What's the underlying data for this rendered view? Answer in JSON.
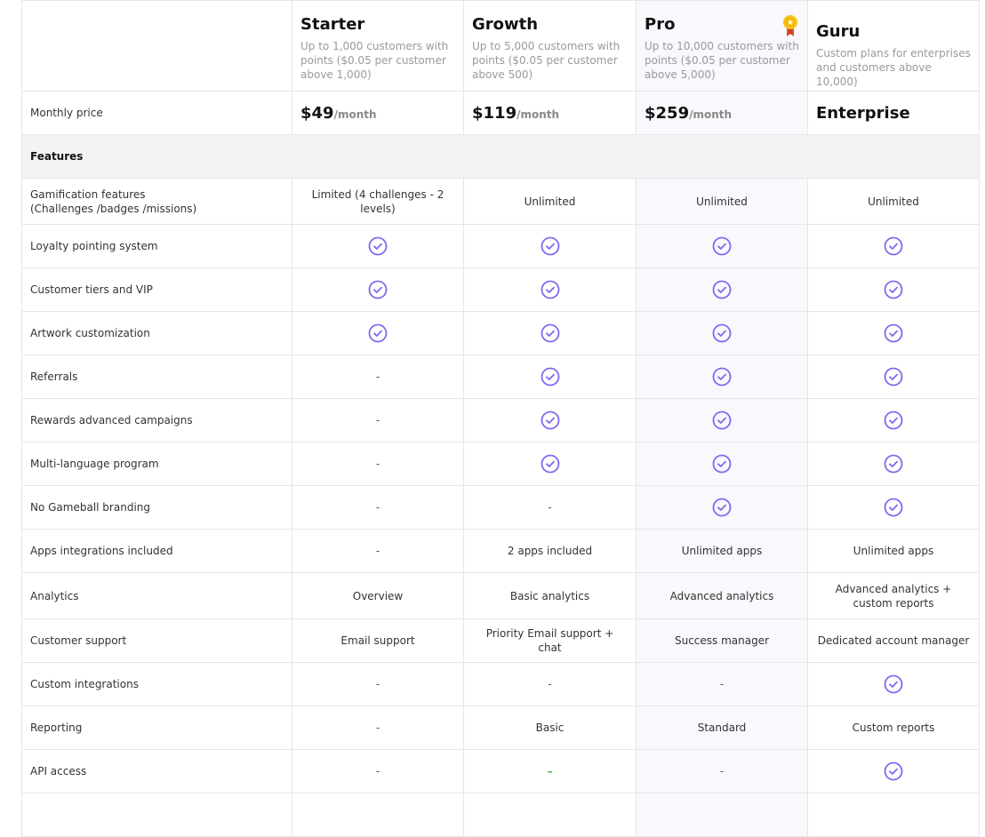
{
  "plans": [
    {
      "name": "Starter",
      "description": "Up to 1,000 customers with points ($0.05 per customer above 1,000)",
      "price": "$49",
      "per": "/month"
    },
    {
      "name": "Growth",
      "description": "Up to 5,000 customers with points ($0.05 per customer above 500)",
      "price": "$119",
      "per": "/month"
    },
    {
      "name": "Pro",
      "description": "Up to 10,000 customers with points ($0.05 per customer above 5,000)",
      "price": "$259",
      "per": "/month",
      "badge": "award-icon"
    },
    {
      "name": "Guru",
      "description": "Custom plans for enterprises and customers above 10,000)",
      "price": "Enterprise",
      "per": ""
    }
  ],
  "price_row_label": "Monthly price",
  "section_label": "Features",
  "colors": {
    "accent": "#7b6cf0",
    "dash_green": "#3bb54a",
    "pro_bg": "#f8f8fd",
    "section_bg": "#f3f3f3"
  },
  "features": [
    {
      "label": "Gamification features\n(Challenges /badges /missions)",
      "values": [
        "Limited (4 challenges - 2 levels)",
        "Unlimited",
        "Unlimited",
        "Unlimited"
      ]
    },
    {
      "label": "Loyalty pointing system",
      "values": [
        "check",
        "check",
        "check",
        "check"
      ]
    },
    {
      "label": "Customer tiers and VIP",
      "values": [
        "check",
        "check",
        "check",
        "check"
      ]
    },
    {
      "label": "Artwork customization",
      "values": [
        "check",
        "check",
        "check",
        "check"
      ]
    },
    {
      "label": "Referrals",
      "values": [
        "-",
        "check",
        "check",
        "check"
      ]
    },
    {
      "label": "Rewards advanced campaigns",
      "values": [
        "-",
        "check",
        "check",
        "check"
      ]
    },
    {
      "label": "Multi-language program",
      "values": [
        "-",
        "check",
        "check",
        "check"
      ]
    },
    {
      "label": "No Gameball branding",
      "values": [
        "-",
        "-",
        "check",
        "check"
      ]
    },
    {
      "label": "Apps integrations included",
      "values": [
        "-",
        "2 apps included",
        "Unlimited apps",
        "Unlimited apps"
      ]
    },
    {
      "label": "Analytics",
      "values": [
        "Overview",
        "Basic analytics",
        "Advanced analytics",
        "Advanced analytics + custom reports"
      ]
    },
    {
      "label": "Customer support",
      "values": [
        "Email support",
        "Priority Email support + chat",
        "Success manager",
        "Dedicated account manager"
      ]
    },
    {
      "label": "Custom integrations",
      "values": [
        "-",
        "-",
        "-",
        "check"
      ]
    },
    {
      "label": "Reporting",
      "values": [
        "-",
        "Basic",
        "Standard",
        "Custom reports"
      ]
    },
    {
      "label": "API access",
      "values": [
        "-",
        "green-dash",
        "-",
        "check"
      ]
    },
    {
      "label": "",
      "values": [
        "",
        "",
        "",
        ""
      ]
    }
  ]
}
